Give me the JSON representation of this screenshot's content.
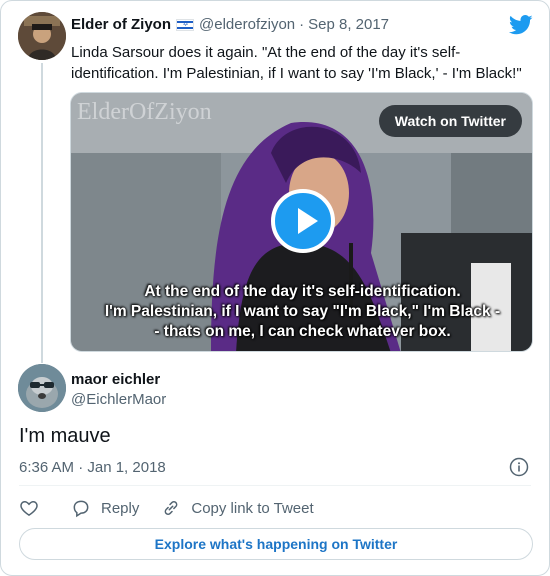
{
  "parent_tweet": {
    "author_name": "Elder of Ziyon",
    "author_handle": "@elderofziyon",
    "separator": "·",
    "date": "Sep 8, 2017",
    "text": "Linda Sarsour does it again. \"At the end  of the day it's self-identification. I'm Palestinian, if I want to say 'I'm Black,' - I'm Black!\"",
    "flag_icon": "israel-flag-icon",
    "media": {
      "watermark": "ElderOfZiyon",
      "watch_button_label": "Watch on Twitter",
      "subtitle_line_1": "At the end  of the day it's self-identification.",
      "subtitle_line_2": "I'm Palestinian, if I want to say \"I'm Black,\" I'm Black -",
      "subtitle_line_3": "- thats on me, I can check whatever box."
    }
  },
  "reply_tweet": {
    "author_name": "maor eichler",
    "author_handle": "@EichlerMaor",
    "text": "I'm mauve",
    "timestamp": "6:36 AM · Jan 1, 2018"
  },
  "actions": {
    "reply_label": "Reply",
    "copy_link_label": "Copy link to Tweet"
  },
  "explore_label": "Explore what's happening on Twitter",
  "colors": {
    "brand_blue": "#1d9bf0",
    "link_blue": "#1d75c6",
    "secondary_text": "#536471",
    "border": "#cfd9de"
  }
}
